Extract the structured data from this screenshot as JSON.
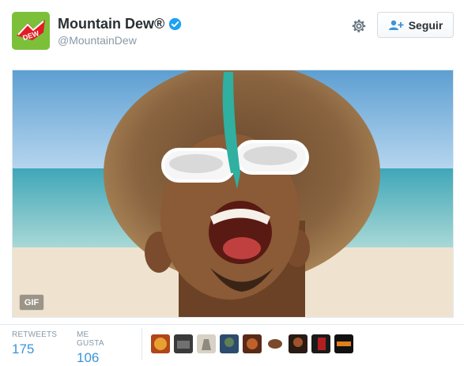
{
  "user": {
    "display_name": "Mountain Dew®",
    "handle": "@MountainDew",
    "avatar_logo_text": "MTN DEW"
  },
  "actions": {
    "follow_label": "Seguir"
  },
  "media": {
    "badge": "GIF"
  },
  "stats": {
    "retweets_label": "RETWEETS",
    "retweets_value": "175",
    "likes_label": "ME GUSTA",
    "likes_value": "106"
  },
  "colors": {
    "brand_green": "#7cc03a",
    "verified_blue": "#1da1f2",
    "link_blue": "#3b94d9"
  }
}
